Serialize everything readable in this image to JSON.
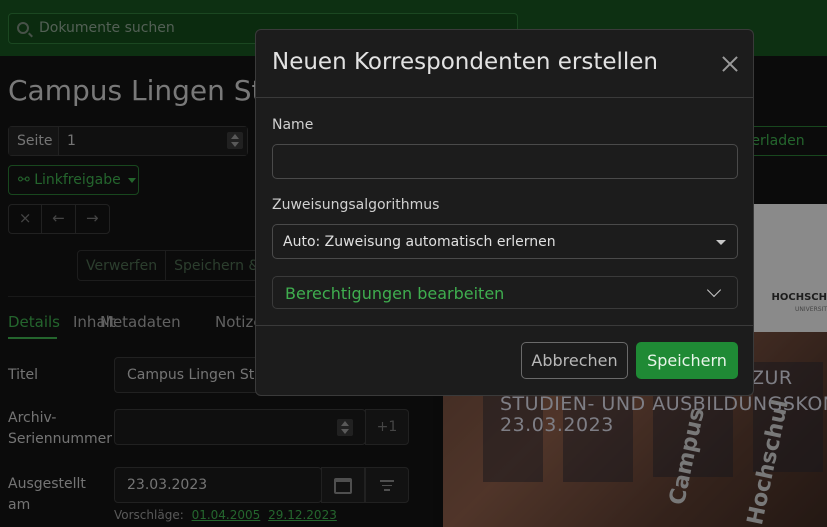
{
  "search": {
    "placeholder": "Dokumente suchen"
  },
  "document": {
    "title": "Campus Lingen Stu",
    "page_label": "Seite",
    "page_value": "1",
    "download_label": "nterladen",
    "link_share_label": "Linkfreigabe",
    "nav": {
      "close": "×",
      "prev": "←",
      "next": "→"
    },
    "discard_label": "Verwerfen",
    "save_label": "Speichern &",
    "tabs": [
      "Details",
      "Inhalt",
      "Metadaten",
      "Notize"
    ],
    "fields": {
      "title_label": "Titel",
      "title_value": "Campus Lingen Stu",
      "asn_label": "Archiv-Seriennummer",
      "asn_increment": "+1",
      "created_label": "Ausgestellt am",
      "created_value": "23.03.2023",
      "suggestions_label": "Vorschläge:",
      "suggestions": [
        "01.04.2005",
        "29.12.2023"
      ]
    }
  },
  "preview": {
    "logo": "HOCHSCH",
    "logo_sub": "UNIVERSIT",
    "line1": "ZUR",
    "line2": "STUDIEN- UND AUSBILDUNGSKON",
    "line3": "23.03.2023",
    "building_sign_1": "Campus",
    "building_sign_2": "Hochschul"
  },
  "modal": {
    "title": "Neuen Korrespondenten erstellen",
    "name_label": "Name",
    "name_value": "",
    "algorithm_label": "Zuweisungsalgorithmus",
    "algorithm_value": "Auto: Zuweisung automatisch erlernen",
    "permissions_label": "Berechtigungen bearbeiten",
    "cancel_label": "Abbrechen",
    "save_label": "Speichern"
  },
  "colors": {
    "topbar": "#17541f",
    "accent_green": "#3fae4f",
    "primary_button": "#1f8a35",
    "modal_bg": "#1c1c1c"
  }
}
